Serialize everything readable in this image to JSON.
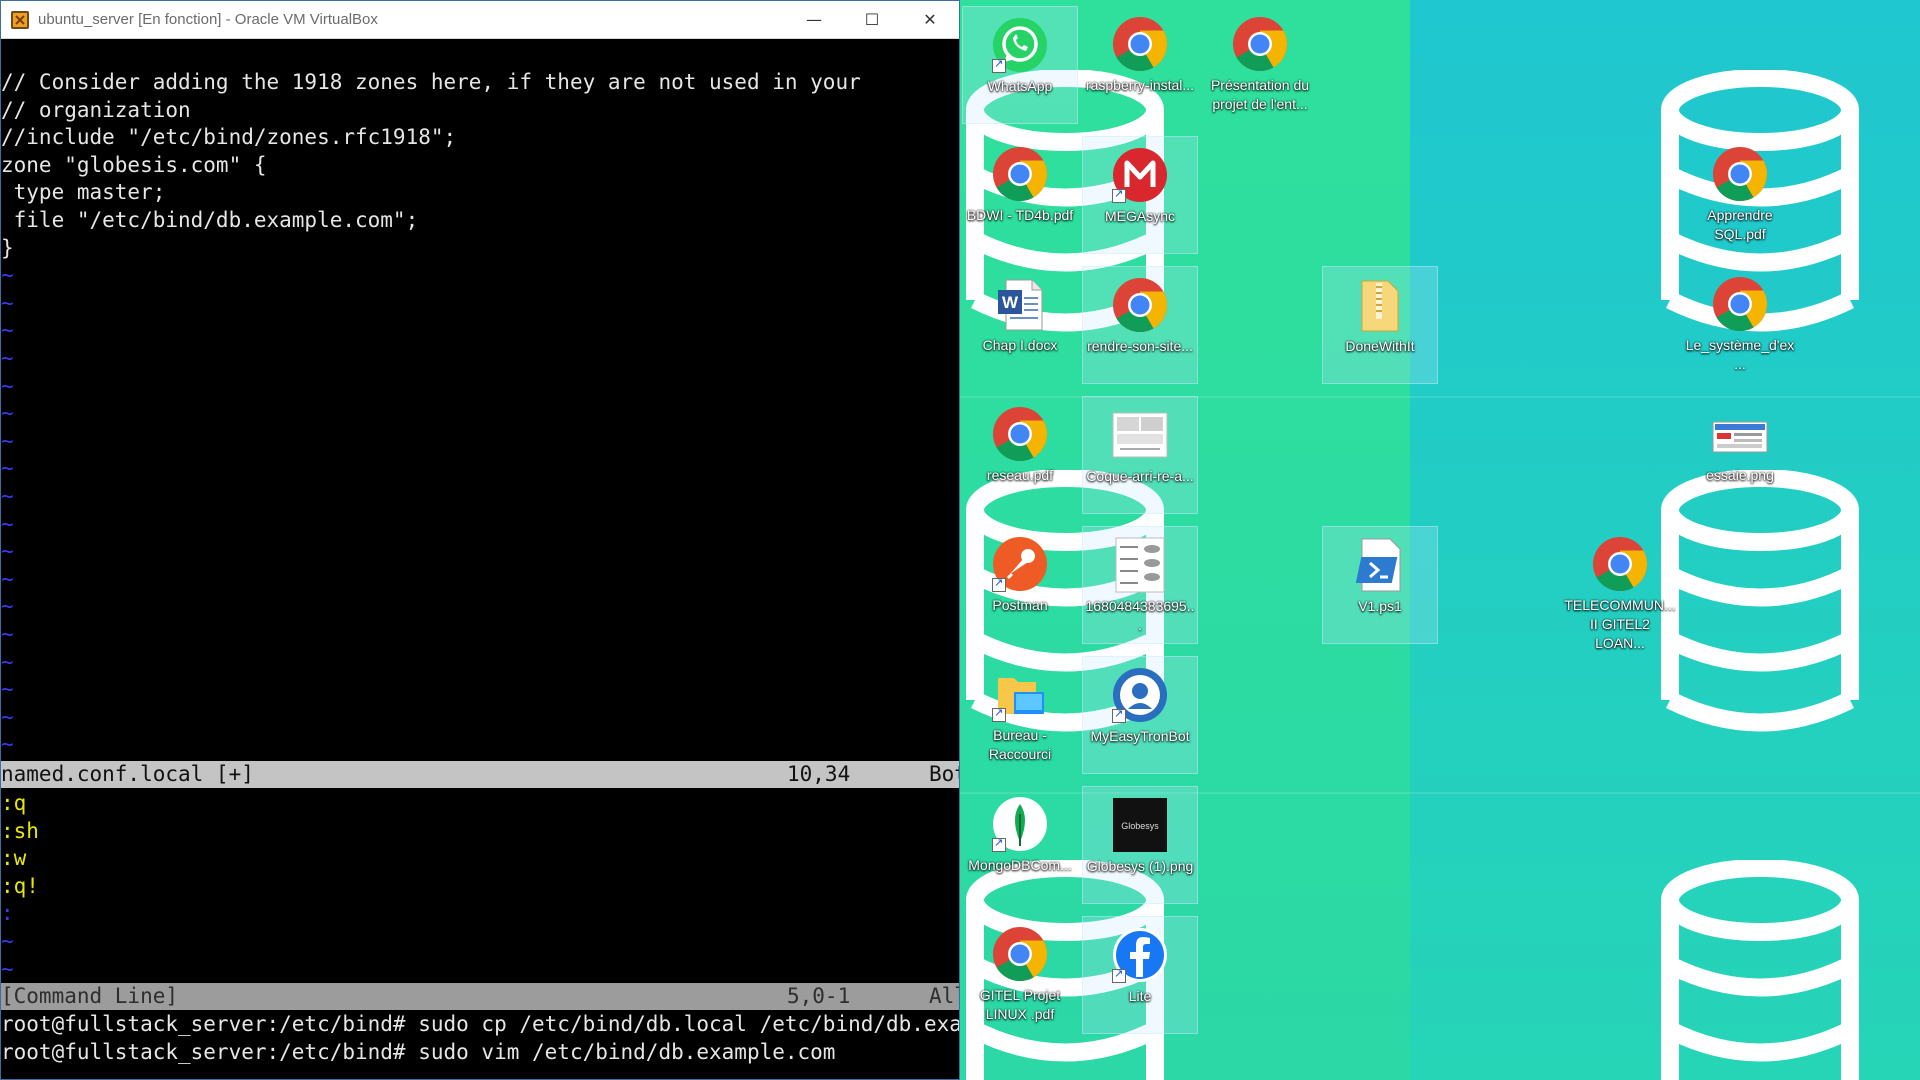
{
  "window": {
    "title": "ubuntu_server [En fonction] - Oracle VM VirtualBox",
    "minimize_glyph": "—",
    "maximize_glyph": "☐",
    "close_glyph": "✕"
  },
  "vim": {
    "lines": [
      "// Consider adding the 1918 zones here, if they are not used in your",
      "// organization",
      "//include \"/etc/bind/zones.rfc1918\";",
      "zone \"globesis.com\" {",
      " type master;",
      " file \"/etc/bind/db.example.com\";",
      "}"
    ],
    "tilde": "~",
    "status": {
      "filename": "named.conf.local [+]",
      "position": "10,34",
      "scroll": "Bot"
    },
    "history": [
      ":q",
      ":sh",
      ":w",
      ":q!"
    ],
    "history_marker": ":",
    "cmdline_status": {
      "label": "[Command Line]",
      "position": "5,0-1",
      "scroll": "All"
    },
    "shell": [
      "root@fullstack_server:/etc/bind# sudo cp /etc/bind/db.local /etc/bind/db.example.com",
      "root@fullstack_server:/etc/bind# sudo vim /etc/bind/db.example.com"
    ]
  },
  "desktop": {
    "icons": {
      "whatsapp": "WhatsApp",
      "raspberry": "raspberry-instal...",
      "presentation": "Présentation du projet de l'ent...",
      "bdw": "BDWI - TD4b.pdf",
      "megasync": "MEGAsync",
      "chap1": "Chap I.docx",
      "rendre": "rendre-son-site...",
      "donewithit": "DoneWithIt",
      "apprendre": "Apprendre SQL.pdf",
      "systeme": "Le_système_d'ex...",
      "reseau": "reseau.pdf",
      "coque": "Coque-arri-re-a...",
      "essaie": "essaie.png",
      "postman": "Postman",
      "num": "1680484383695...",
      "v1": "V1.ps1",
      "telecom": "TELECOMMUN... II GITEL2 LOAN...",
      "bureau": "Bureau - Raccourci",
      "myeasy": "MyEasyTronBot",
      "mongo": "MongoDBCom...",
      "globesys": "Globesys (1).png",
      "globesys_logo": "Globesys",
      "gitel": "GITEL Projet LINUX .pdf",
      "lite": "Lite"
    }
  },
  "colors": {
    "terminal_bg": "#000000",
    "vim_tilde": "#3a3af0",
    "history_text": "#e8e800",
    "wallpaper_green": "#2fe09c",
    "wallpaper_cyan": "#1fc7d0"
  }
}
